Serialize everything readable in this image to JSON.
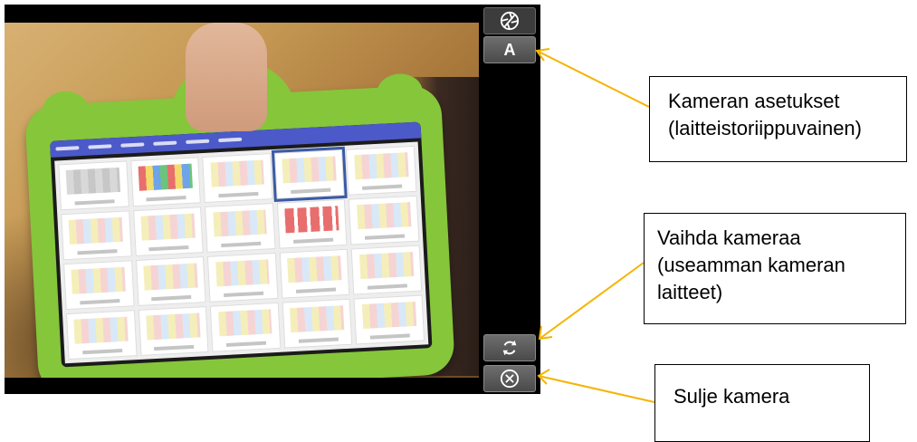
{
  "camera": {
    "tablet_bar_items": [
      "",
      "",
      "",
      "",
      "",
      ""
    ],
    "tiles": [
      {
        "kind": "gray"
      },
      {
        "kind": "colors"
      },
      {
        "kind": "plain"
      },
      {
        "kind": "selected"
      },
      {
        "kind": "plain"
      },
      {
        "kind": "plain"
      },
      {
        "kind": "plain"
      },
      {
        "kind": "plain"
      },
      {
        "kind": "reds"
      },
      {
        "kind": "plain"
      },
      {
        "kind": "plain"
      },
      {
        "kind": "plain"
      },
      {
        "kind": "plain"
      },
      {
        "kind": "plain"
      },
      {
        "kind": "plain"
      },
      {
        "kind": "plain"
      },
      {
        "kind": "plain"
      },
      {
        "kind": "plain"
      },
      {
        "kind": "plain"
      },
      {
        "kind": "plain"
      }
    ]
  },
  "controls": {
    "settings_auto_label": "A",
    "icons": {
      "shutter": "aperture-icon",
      "switch_camera": "switch-camera-icon",
      "close": "close-circle-icon"
    }
  },
  "callouts": {
    "settings_lines": [
      "Kameran asetukset",
      "(laitteistoriippuvainen)"
    ],
    "switch_lines": [
      "Vaihda kameraa",
      "(useamman kameran",
      "laitteet)"
    ],
    "close_lines": [
      "Sulje kamera"
    ]
  },
  "colors": {
    "arrow": "#f5b400",
    "case_green": "#86c63a",
    "tablet_header": "#4c59c9"
  }
}
